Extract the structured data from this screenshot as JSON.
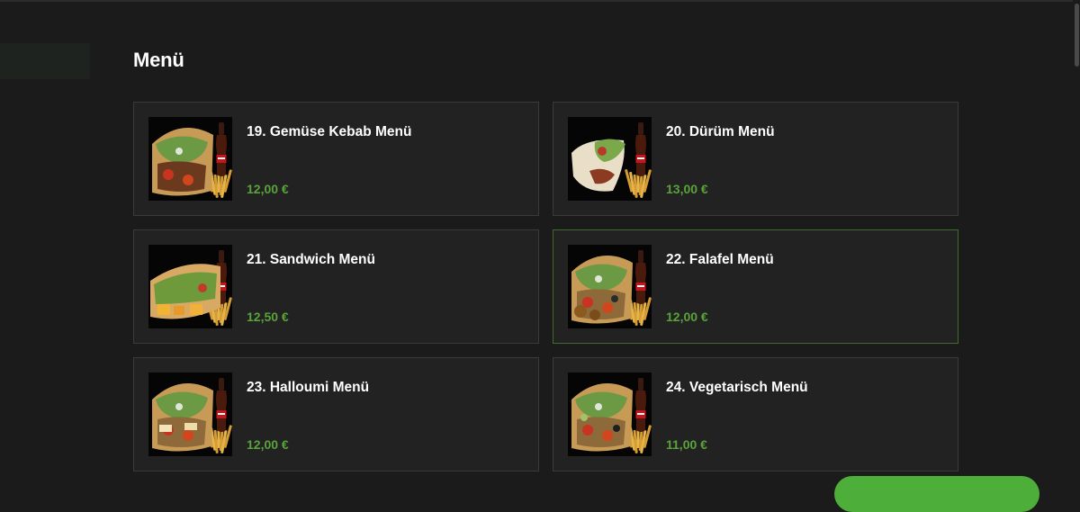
{
  "section": {
    "title": "Menü"
  },
  "items": [
    {
      "name": "19. Gemüse Kebab Menü",
      "price": "12,00 €",
      "image_icon": "kebab-menu-photo"
    },
    {
      "name": "20. Dürüm Menü",
      "price": "13,00 €",
      "image_icon": "durum-menu-photo"
    },
    {
      "name": "21. Sandwich Menü",
      "price": "12,50 €",
      "image_icon": "sandwich-menu-photo"
    },
    {
      "name": "22. Falafel Menü",
      "price": "12,00 €",
      "image_icon": "falafel-menu-photo"
    },
    {
      "name": "23. Halloumi Menü",
      "price": "12,00 €",
      "image_icon": "halloumi-menu-photo"
    },
    {
      "name": "24. Vegetarisch Menü",
      "price": "11,00 €",
      "image_icon": "vegetarian-menu-photo"
    }
  ],
  "colors": {
    "background": "#1b1b1b",
    "card": "#222222",
    "price": "#5aa33a",
    "active_border": "#3f6b2c",
    "cta": "#4eae3a"
  }
}
